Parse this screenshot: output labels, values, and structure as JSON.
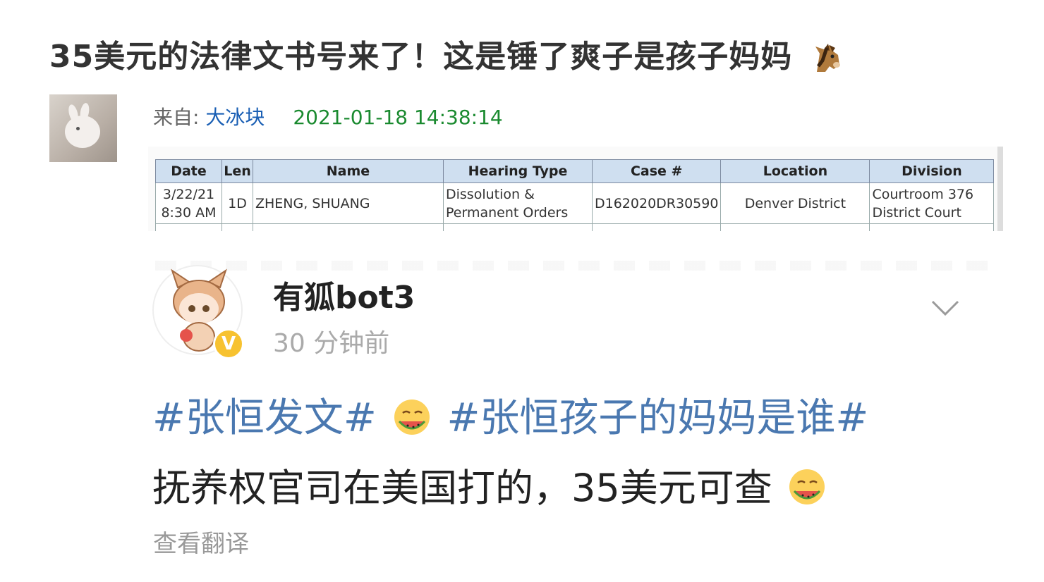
{
  "article": {
    "title": "35美元的法律文书号来了！这是锤了爽子是孩子妈妈",
    "title_emoji": "horse-face-icon",
    "from_label": "来自: ",
    "author": "大冰块",
    "timestamp": "2021-01-18 14:38:14"
  },
  "court_table": {
    "headers": [
      "Date",
      "Len",
      "Name",
      "Hearing Type",
      "Case #",
      "Location",
      "Division"
    ],
    "row": {
      "date_line1": "3/22/21",
      "date_line2": "8:30 AM",
      "len": "1D",
      "name": "ZHENG, SHUANG",
      "hearing_line1": "Dissolution &",
      "hearing_line2": "Permanent Orders",
      "case": "D162020DR30590",
      "location": "Denver District",
      "division_line1": "Courtroom 376",
      "division_line2": "District Court"
    }
  },
  "weibo_post": {
    "username": "有狐bot3",
    "verified_mark": "V",
    "time_ago": "30 分钟前",
    "hashtag1": "#张恒发文#",
    "hashtag2": "#张恒孩子的妈妈是谁#",
    "body_text": "抚养权官司在美国打的，35美元可查",
    "translate_label": "查看翻译",
    "emoji_name": "eating-watermelon-emoji"
  },
  "colors": {
    "hashtag": "#4a78b0",
    "author_link": "#1a5fb4",
    "timestamp": "#1a8a2f",
    "verified_badge": "#f7c230",
    "table_header": "#cfdff0"
  }
}
